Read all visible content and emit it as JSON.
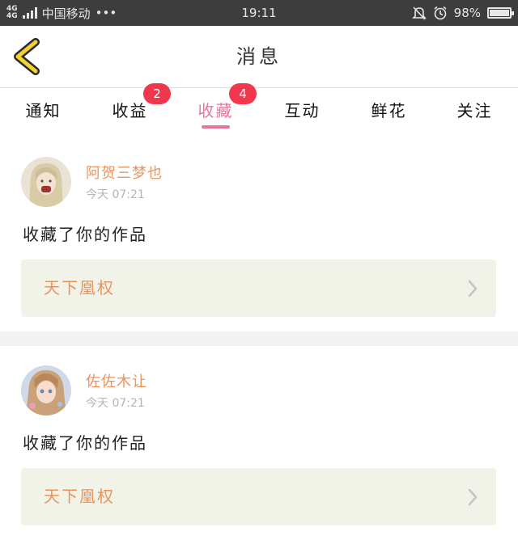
{
  "status_bar": {
    "network_top": "4G",
    "network_bottom": "4G",
    "carrier": "中国移动",
    "more": "•••",
    "time": "19:11",
    "battery_percent": "98%",
    "battery_level": 0.98,
    "icons": [
      "signal-icon",
      "mute-bell-icon",
      "alarm-icon",
      "battery-icon"
    ]
  },
  "header": {
    "back_icon": "chevron-left-icon",
    "accent_color": "#f0d233",
    "title": "消息"
  },
  "tabs": [
    {
      "label": "通知",
      "badge": "",
      "active": false
    },
    {
      "label": "收益",
      "badge": "2",
      "active": false
    },
    {
      "label": "收藏",
      "badge": "4",
      "active": true
    },
    {
      "label": "互动",
      "badge": "",
      "active": false
    },
    {
      "label": "鲜花",
      "badge": "",
      "active": false
    },
    {
      "label": "关注",
      "badge": "",
      "active": false
    }
  ],
  "colors": {
    "active_tab": "#e8739b",
    "badge": "#f0374c",
    "username": "#e8945e",
    "work_card_bg": "#f1f2e8"
  },
  "feed": [
    {
      "username": "阿贺三梦也",
      "time": "今天 07:21",
      "message": "收藏了你的作品",
      "work_title": "天下凰权"
    },
    {
      "username": "佐佐木让",
      "time": "今天 07:21",
      "message": "收藏了你的作品",
      "work_title": "天下凰权"
    }
  ]
}
